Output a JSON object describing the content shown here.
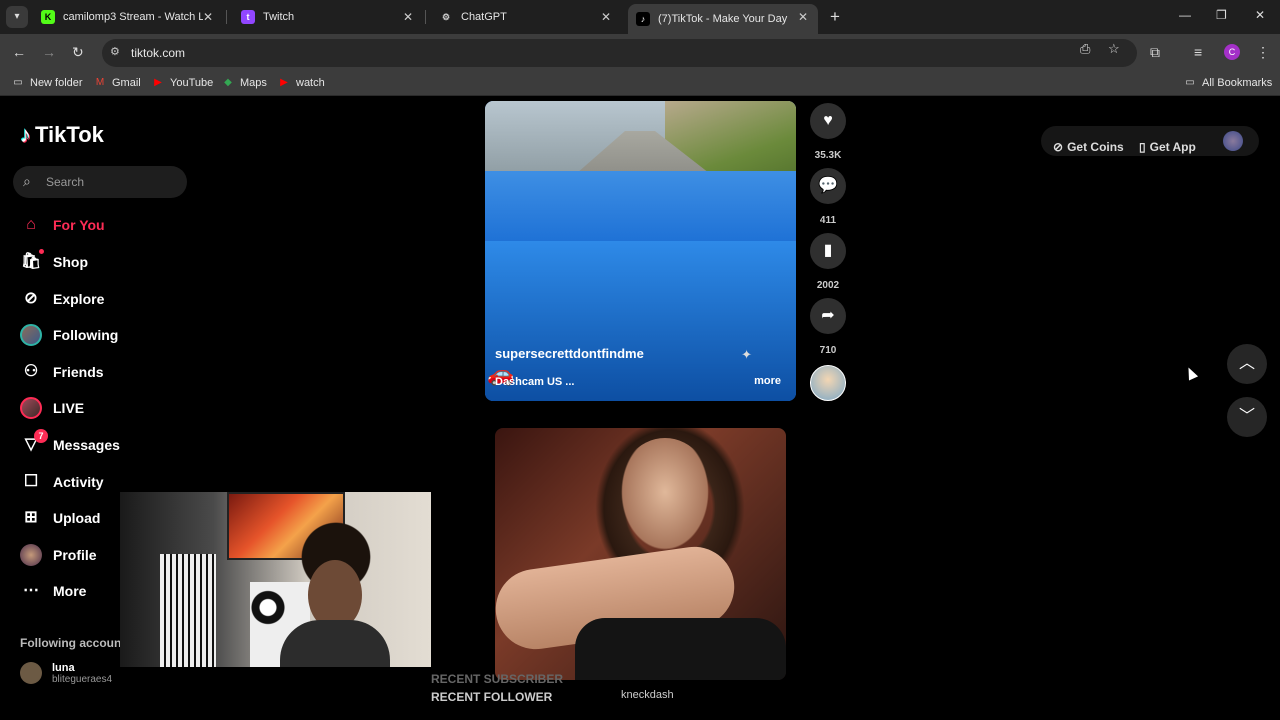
{
  "browser": {
    "tabs": [
      {
        "label": "camilomp3 Stream - Watch Live",
        "favicon": "kick-icon",
        "favicon_glyph": "K",
        "color": "#53fc18"
      },
      {
        "label": "Twitch",
        "favicon": "twitch-icon",
        "favicon_glyph": "t",
        "color": "#9146ff"
      },
      {
        "label": "ChatGPT",
        "favicon": "chatgpt-icon",
        "favicon_glyph": "⚙",
        "color": "#cccccc"
      },
      {
        "label": "(7)TikTok - Make Your Day",
        "favicon": "tiktok-icon",
        "favicon_glyph": "♪",
        "color": "#ffffff",
        "active": true
      }
    ],
    "url": "tiktok.com",
    "profile_initial": "C",
    "bookmarks": [
      {
        "label": "New folder",
        "icon": "folder-icon"
      },
      {
        "label": "Gmail",
        "icon": "gmail-icon"
      },
      {
        "label": "YouTube",
        "icon": "youtube-icon"
      },
      {
        "label": "Maps",
        "icon": "maps-icon"
      },
      {
        "label": "watch",
        "icon": "youtube-icon"
      }
    ],
    "all_bookmarks": "All Bookmarks"
  },
  "tiktok": {
    "logo": "TikTok",
    "search_placeholder": "Search",
    "nav": [
      {
        "label": "For You",
        "icon": "home-icon",
        "active": true
      },
      {
        "label": "Shop",
        "icon": "shop-icon"
      },
      {
        "label": "Explore",
        "icon": "compass-icon"
      },
      {
        "label": "Following",
        "icon": "following-avatar"
      },
      {
        "label": "Friends",
        "icon": "friends-icon"
      },
      {
        "label": "LIVE",
        "icon": "live-avatar"
      },
      {
        "label": "Messages",
        "icon": "messages-icon",
        "badge": "7"
      },
      {
        "label": "Activity",
        "icon": "activity-icon"
      },
      {
        "label": "Upload",
        "icon": "upload-icon"
      },
      {
        "label": "Profile",
        "icon": "profile-avatar"
      },
      {
        "label": "More",
        "icon": "more-icon"
      }
    ],
    "following_accounts_title": "Following account",
    "following_accounts": [
      {
        "name": "luna",
        "handle": "blitegueraes4"
      }
    ],
    "video1": {
      "author": "supersecrettdontfindme",
      "description": "Dashcam US ...",
      "more": "more",
      "likes": "35.3K",
      "comments": "411",
      "bookmarks": "2002",
      "shares": "710"
    },
    "top_right": {
      "get_coins": "Get Coins",
      "get_app": "Get App"
    }
  },
  "stream_overlay": {
    "recent_subscriber": "RECENT SUBSCRIBER",
    "recent_follower": "RECENT FOLLOWER",
    "follower_name": "kneckdash"
  }
}
